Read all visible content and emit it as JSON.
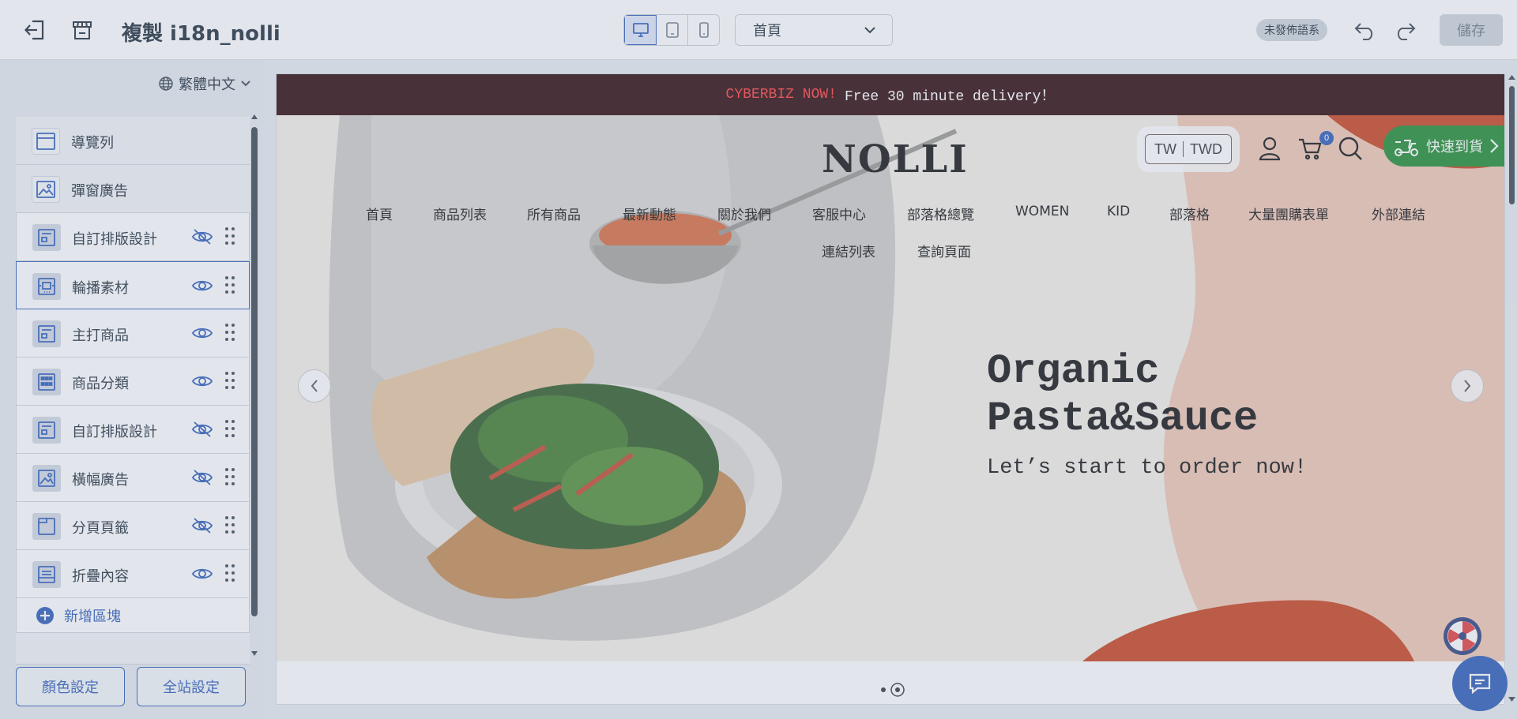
{
  "header": {
    "title": "複製 i18n_nolli",
    "page_select": "首頁",
    "unpublished_badge": "未發佈語系",
    "save_label": "儲存"
  },
  "left_panel": {
    "language": "繁體中文",
    "blocks": [
      {
        "label": "導覽列",
        "icon": "navbar-block-icon",
        "visible": null
      },
      {
        "label": "彈窗廣告",
        "icon": "image-block-icon",
        "visible": null
      },
      {
        "label": "自訂排版設計",
        "icon": "layout-block-icon",
        "visible": false
      },
      {
        "label": "輪播素材",
        "icon": "carousel-block-icon",
        "visible": true
      },
      {
        "label": "主打商品",
        "icon": "layout-block-icon",
        "visible": true
      },
      {
        "label": "商品分類",
        "icon": "grid-block-icon",
        "visible": true
      },
      {
        "label": "自訂排版設計",
        "icon": "layout-block-icon",
        "visible": false
      },
      {
        "label": "橫幅廣告",
        "icon": "image-block-icon",
        "visible": false
      },
      {
        "label": "分頁頁籤",
        "icon": "tab-block-icon",
        "visible": false
      },
      {
        "label": "折疊內容",
        "icon": "accordion-block-icon",
        "visible": true
      }
    ],
    "add_block_label": "新增區塊",
    "color_settings_label": "顏色設定",
    "site_settings_label": "全站設定"
  },
  "preview": {
    "announcement_brand": "CYBERBIZ NOW!",
    "announcement_text": "Free 30 minute delivery！",
    "logo": "NOLLI",
    "currency_region": "TW",
    "currency_code": "TWD",
    "cart_count": "0",
    "quick_delivery_label": "快速到貨",
    "nav_items": [
      "首頁",
      "商品列表",
      "所有商品",
      "最新動態",
      "關於我們",
      "客服中心",
      "部落格總覽",
      "WOMEN",
      "KID",
      "部落格",
      "大量團購表單",
      "外部連結",
      "連結列表",
      "查詢頁面"
    ],
    "hero_title_line1": "Organic",
    "hero_title_line2": "Pasta&Sauce",
    "hero_subtitle": "Let’s start to order now!",
    "colors": {
      "announcement_bg": "#2b0507",
      "brand_red": "#ff3b3b",
      "quick_delivery_green": "#1f8a2e",
      "accent_blue": "#2c59b8",
      "hero_orange": "#c8401b",
      "hero_peach": "#f2c7b3"
    }
  }
}
